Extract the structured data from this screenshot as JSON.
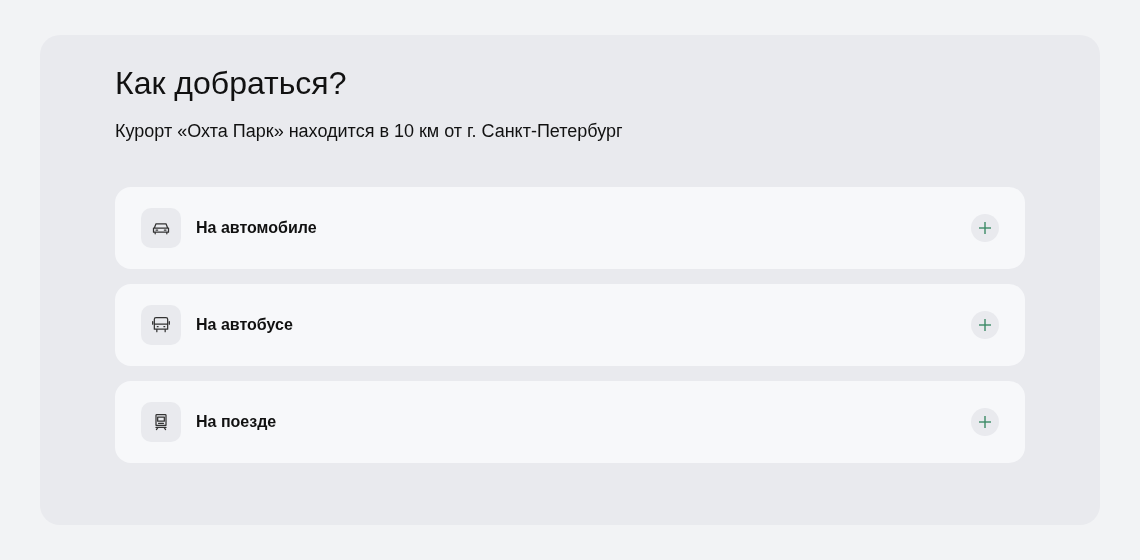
{
  "title": "Как добраться?",
  "subtitle": "Курорт «Охта Парк» находится в 10 км от г. Санкт-Петербург",
  "items": [
    {
      "kind": "car",
      "label": "На автомобиле",
      "expanded": false
    },
    {
      "kind": "bus",
      "label": "На автобусе",
      "expanded": false
    },
    {
      "kind": "train",
      "label": "На поезде",
      "expanded": false
    }
  ]
}
